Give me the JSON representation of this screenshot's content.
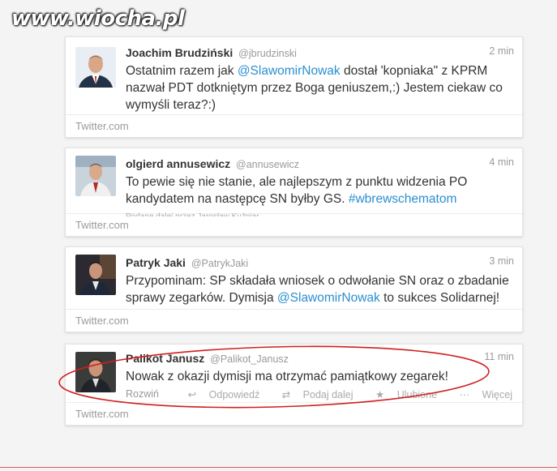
{
  "watermark": "www.wiocha.pl",
  "tweets": [
    {
      "name": "Joachim Brudziński",
      "handle": "@jbrudzinski",
      "time": "2 min",
      "text_parts": [
        "Ostatnim razem jak ",
        "@SlawomirNowak",
        " dostał 'kopniaka\" z KPRM nazwał PDT dotkniętym przez Boga geniuszem,:) Jestem ciekaw co wymyśli teraz?:)"
      ],
      "footer": "Twitter.com"
    },
    {
      "name": "olgierd annusewicz",
      "handle": "@annusewicz",
      "time": "4 min",
      "text_parts": [
        "To pewie się nie stanie, ale najlepszym z punktu widzenia PO kandydatem na następcę SN byłby GS. ",
        "#wbrewschematom"
      ],
      "faded": "Podane dalej przez Jarosław Kuźniar",
      "footer": "Twitter.com"
    },
    {
      "name": "Patryk Jaki",
      "handle": "@PatrykJaki",
      "time": "3 min",
      "text_parts": [
        "Przypominam: SP składała wniosek o odwołanie SN oraz o zbadanie sprawy zegarków. Dymisja ",
        "@SlawomirNowak",
        " to sukces Solidarnej!"
      ],
      "footer": "Twitter.com"
    },
    {
      "name": "Palikot Janusz",
      "handle": "@Palikot_Janusz",
      "time": "11 min",
      "text": "Nowak z okazji dymisji ma otrzymać pamiątkowy zegarek!",
      "actions": {
        "expand": "Rozwiń",
        "reply": "Odpowiedź",
        "retweet": "Podaj dalej",
        "favorite": "Ulubione",
        "more": "Więcej"
      },
      "footer": "Twitter.com"
    }
  ],
  "colors": {
    "link": "#2a8fcf",
    "annotation": "#d01f1f"
  }
}
